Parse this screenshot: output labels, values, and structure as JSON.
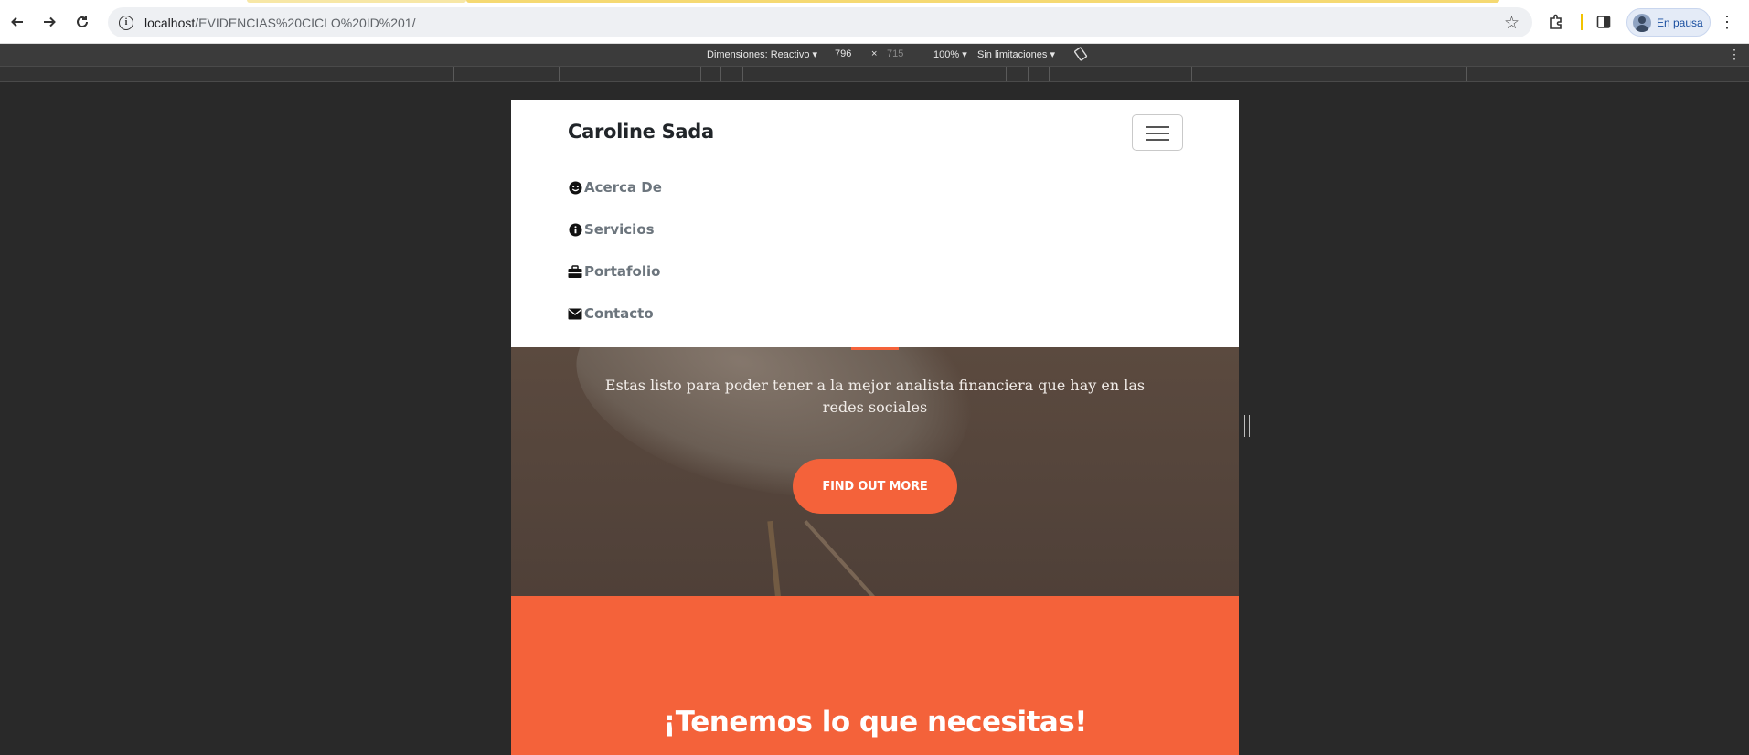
{
  "browser": {
    "url_host": "localhost",
    "url_path": "/EVIDENCIAS%20CICLO%20ID%201/",
    "profile_label": "En pausa"
  },
  "devtools": {
    "dimensions_label": "Dimensiones: Reactivo",
    "width": "796",
    "times": "×",
    "height": "715",
    "zoom": "100%",
    "throttle": "Sin limitaciones"
  },
  "navbar": {
    "brand": "Caroline Sada",
    "links": [
      {
        "label": "Acerca De",
        "icon": "smile-icon"
      },
      {
        "label": "Servicios",
        "icon": "info-icon"
      },
      {
        "label": "Portafolio",
        "icon": "briefcase-icon"
      },
      {
        "label": "Contacto",
        "icon": "envelope-icon"
      }
    ]
  },
  "hero": {
    "tagline": "Estas listo para poder tener a la mejor analista financiera que hay en las redes sociales",
    "cta": "FIND OUT MORE"
  },
  "services": {
    "heading": "¡Tenemos lo que necesitas!"
  },
  "colors": {
    "accent": "#f4623a",
    "hero_bg": "#5b4a3f",
    "page_bg": "#292929"
  }
}
